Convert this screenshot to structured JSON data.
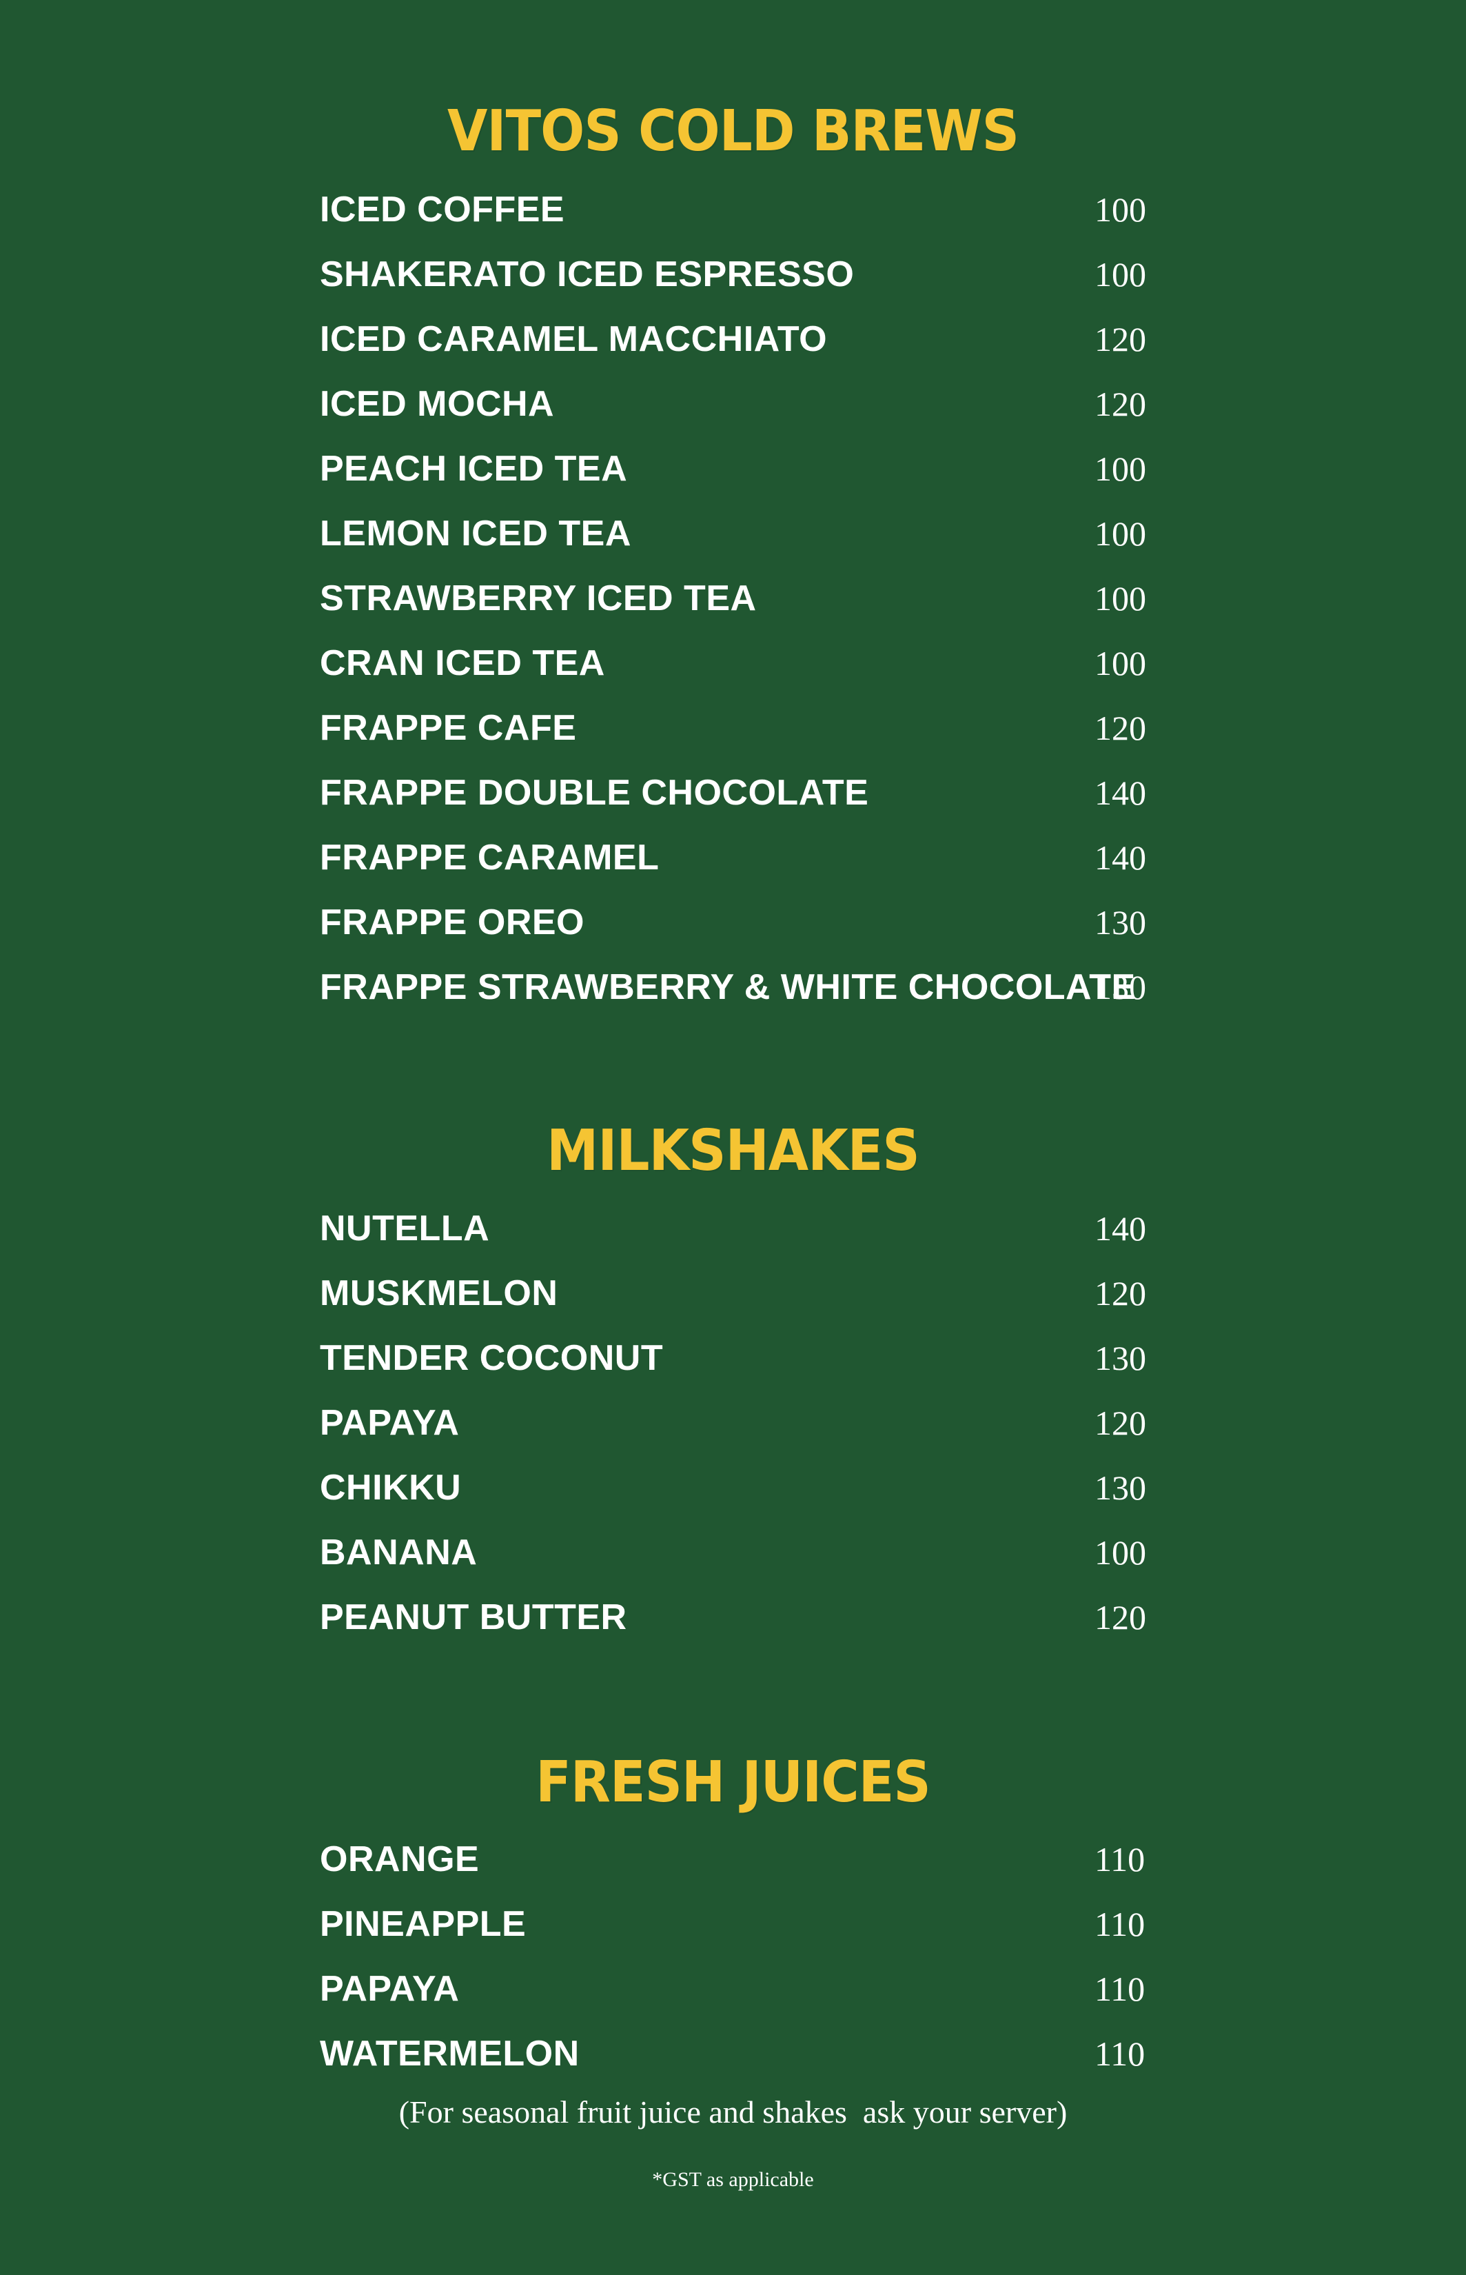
{
  "sections": [
    {
      "title": "VITOS COLD BREWS",
      "items": [
        {
          "name": "ICED COFFEE",
          "price": "100"
        },
        {
          "name": "SHAKERATO ICED ESPRESSO",
          "price": "100"
        },
        {
          "name": "ICED CARAMEL MACCHIATO",
          "price": "120"
        },
        {
          "name": "ICED MOCHA",
          "price": "120"
        },
        {
          "name": "PEACH ICED TEA",
          "price": "100"
        },
        {
          "name": "LEMON ICED TEA",
          "price": "100"
        },
        {
          "name": "STRAWBERRY ICED TEA",
          "price": "100"
        },
        {
          "name": "CRAN ICED TEA",
          "price": "100"
        },
        {
          "name": "FRAPPE CAFE",
          "price": "120"
        },
        {
          "name": "FRAPPE DOUBLE CHOCOLATE",
          "price": "140"
        },
        {
          "name": "FRAPPE CARAMEL",
          "price": "140"
        },
        {
          "name": "FRAPPE OREO",
          "price": "130"
        },
        {
          "name": "FRAPPE STRAWBERRY & WHITE CHOCOLATE",
          "price": "130"
        }
      ]
    },
    {
      "title": "MILKSHAKES",
      "items": [
        {
          "name": "NUTELLA",
          "price": "140"
        },
        {
          "name": "MUSKMELON",
          "price": "120"
        },
        {
          "name": "TENDER COCONUT",
          "price": "130"
        },
        {
          "name": "PAPAYA",
          "price": "120"
        },
        {
          "name": "CHIKKU",
          "price": "130"
        },
        {
          "name": "BANANA",
          "price": "100"
        },
        {
          "name": "PEANUT BUTTER",
          "price": "120"
        }
      ]
    },
    {
      "title": "FRESH JUICES",
      "items": [
        {
          "name": "ORANGE",
          "price": "110"
        },
        {
          "name": "PINEAPPLE",
          "price": "110"
        },
        {
          "name": "PAPAYA",
          "price": "110"
        },
        {
          "name": "WATERMELON",
          "price": "110"
        }
      ]
    }
  ],
  "notes": {
    "seasonal": "(For seasonal fruit juice and shakes  ask your server)",
    "gst": "*GST as applicable"
  },
  "colors": {
    "background": "#205731",
    "heading": "#f5c433",
    "text": "#ffffff"
  }
}
